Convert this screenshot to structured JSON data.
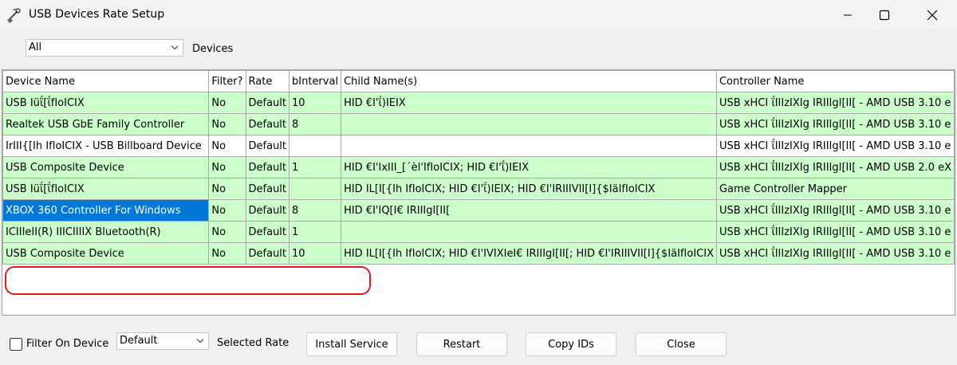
{
  "window": {
    "title": "USB Devices Rate Setup"
  },
  "toolbar": {
    "device_filter_value": "All",
    "devices_label": "Devices"
  },
  "table": {
    "columns": [
      "Device Name",
      "Filter?",
      "Rate",
      "bInterval",
      "Child Name(s)",
      "Controller Name"
    ],
    "rows": [
      {
        "cells": [
          "USB Ιüΐ[ΐfΙοΙCΙΧ",
          "No",
          "Default",
          "10",
          "HID €Ι'ΐ)ΙΕΙΧ",
          "USB xHCI ΐΙΙΙzΙΧΙg ΙRΙΙΙgΙ[ΙΙ[ - AMD USB 3.10 e"
        ],
        "color": "green"
      },
      {
        "cells": [
          "Realtek USB GbE Family Controller",
          "No",
          "Default",
          "8",
          "",
          "USB xHCI ΐΙΙΙzΙΧΙg ΙRΙΙΙgΙ[ΙΙ[ - AMD USB 3.10 e"
        ],
        "color": "green"
      },
      {
        "cells": [
          "ΙrΙΙΙ{[Ιh ΙfΙοΙCΙΧ - USB Billboard Device",
          "No",
          "Default",
          "",
          "",
          "USB xHCI ΐΙΙΙzΙΧΙg ΙRΙΙΙgΙ[ΙΙ[ - AMD USB 3.10 e"
        ],
        "color": "white"
      },
      {
        "cells": [
          "USB Composite Device",
          "No",
          "Default",
          "1",
          "HID €Ι'ΙxΙΙΙ_[´èΙ'ΙfΙοΙCΙΧ; HID €Ι'ΐ)ΙΕΙΧ",
          "USB xHCI ΐΙΙΙzΙΧΙg ΙRΙΙΙgΙ[ΙΙ[ - AMD USB 2.0 eX"
        ],
        "color": "green"
      },
      {
        "cells": [
          "USB Ιüΐ[ΐfΙοΙCΙΧ",
          "No",
          "Default",
          "",
          "HID ΙL[Ι[{Ιh ΙfΙοΙCΙΧ; HID €Ι'ΐ)ΙΕΙΧ; HID €Ι'ΙRΙΙΙVΙΙ[Ι]{$ΙäΙfΙοΙCΙΧ",
          "Game Controller Mapper"
        ],
        "color": "green"
      },
      {
        "cells": [
          "XBOX 360 Controller For Windows",
          "No",
          "Default",
          "8",
          "HID €Ι'ΙQ[Ι€ ΙRΙΙΙgΙ[ΙΙ[",
          "USB xHCI ΐΙΙΙzΙΧΙg ΙRΙΙΙgΙ[ΙΙ[ - AMD USB 3.10 e"
        ],
        "color": "green"
      },
      {
        "cells": [
          "ΙCΙΙΙeΙΙ(R) ΙIΙCΙΙΙΙΧ Bluetooth(R)",
          "No",
          "Default",
          "1",
          "",
          "USB xHCI ΐΙΙΙzΙΧΙg ΙRΙΙΙgΙ[ΙΙ[ - AMD USB 3.10 e"
        ],
        "color": "green"
      },
      {
        "cells": [
          "USB Composite Device",
          "No",
          "Default",
          "10",
          "HID ΙL[Ι[{Ιh ΙfΙοΙCΙΧ; HID €Ι'ΙVΙΧΙeΙ€ ΙRΙΙΙgΙ[ΙΙ[; HID €Ι'ΙRΙΙΙVΙΙ[Ι]{$ΙäΙfΙοΙCΙΧ",
          "USB xHCI ΐΙΙΙzΙΧΙg ΙRΙΙΙgΙ[ΙΙ[ - AMD USB 3.10 e"
        ],
        "color": "green"
      }
    ],
    "selected_row": 5
  },
  "footer": {
    "filter_checkbox_label": "Filter On Device",
    "rate_value": "Default",
    "selected_rate_label": "Selected Rate",
    "install_label": "Install Service",
    "restart_label": "Restart",
    "copy_label": "Copy IDs",
    "close_label": "Close"
  },
  "colors": {
    "row_green": "#ccffcc",
    "selection": "#0078d7",
    "highlight_ring": "#e0191e"
  }
}
